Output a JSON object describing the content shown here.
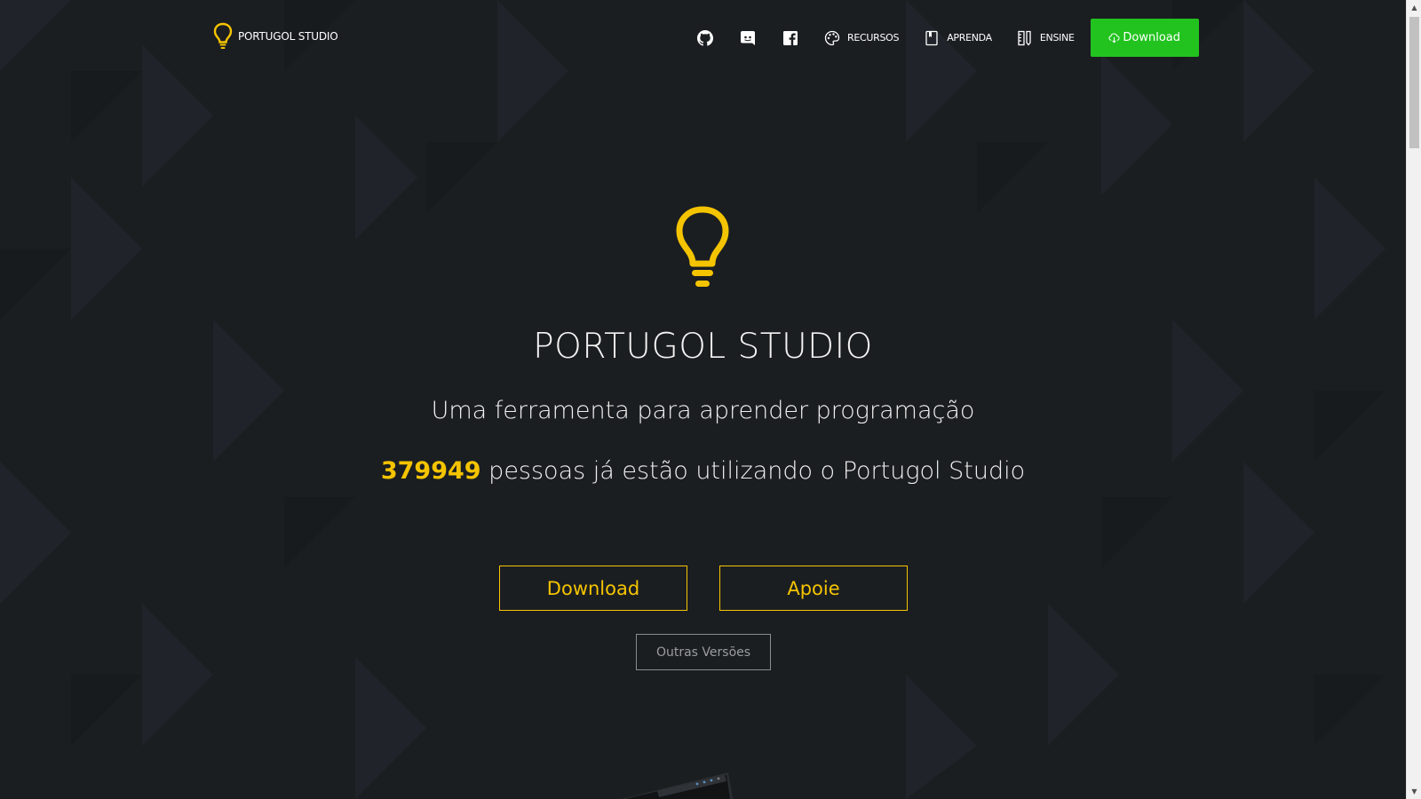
{
  "brand": {
    "name": "PORTUGOL STUDIO",
    "icon": "lightbulb-icon"
  },
  "nav": {
    "github_icon": "github-icon",
    "discord_icon": "discord-icon",
    "facebook_icon": "facebook-icon",
    "recursos": "RECURSOS",
    "aprenda": "APRENDA",
    "ensine": "ENSINE",
    "download": "Download"
  },
  "hero": {
    "title": "PORTUGOL STUDIO",
    "subtitle": "Uma ferramenta para aprender programação",
    "count": "379949",
    "count_text": " pessoas já estão utilizando o Portugol Studio",
    "download_button": "Download",
    "support_button": "Apoie",
    "other_versions_button": "Outras Versões"
  },
  "colors": {
    "background": "#1b1e21",
    "accent_yellow": "#f5c400",
    "download_green": "#22c31f"
  }
}
